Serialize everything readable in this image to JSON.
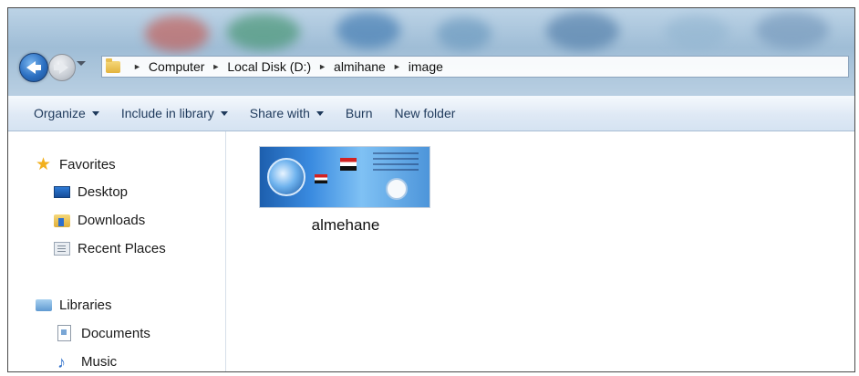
{
  "address_bar": {
    "breadcrumbs": [
      "Computer",
      "Local Disk (D:)",
      "almihane",
      "image"
    ]
  },
  "command_bar": {
    "organize": "Organize",
    "include_in_library": "Include in library",
    "share_with": "Share with",
    "burn": "Burn",
    "new_folder": "New folder"
  },
  "nav_pane": {
    "favorites": {
      "label": "Favorites",
      "items": [
        {
          "label": "Desktop",
          "icon": "desktop-icon"
        },
        {
          "label": "Downloads",
          "icon": "downloads-folder-icon"
        },
        {
          "label": "Recent Places",
          "icon": "recent-places-icon"
        }
      ]
    },
    "libraries": {
      "label": "Libraries",
      "items": [
        {
          "label": "Documents",
          "icon": "documents-icon"
        },
        {
          "label": "Music",
          "icon": "music-note-icon"
        }
      ]
    }
  },
  "content": {
    "files": [
      {
        "name": "almehane",
        "type": "image"
      }
    ]
  },
  "colors": {
    "command_text": "#1e395b",
    "favorites_star": "#f2b01e",
    "back_button": "#2b6fc1"
  }
}
